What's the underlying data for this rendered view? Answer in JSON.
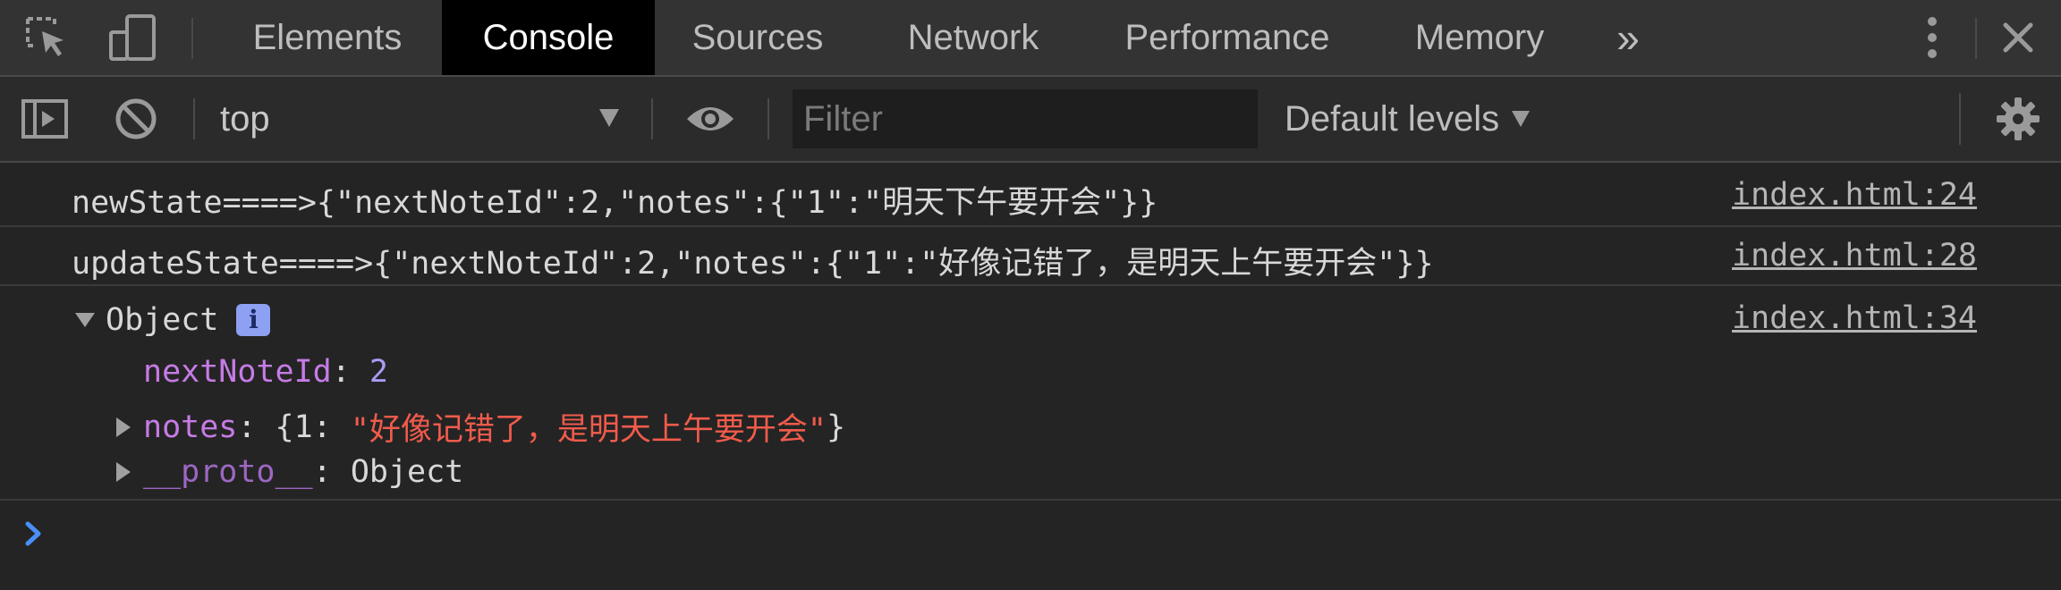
{
  "tabs": {
    "elements": "Elements",
    "console": "Console",
    "sources": "Sources",
    "network": "Network",
    "performance": "Performance",
    "memory": "Memory",
    "more": "»"
  },
  "toolbar": {
    "context": "top",
    "filter_placeholder": "Filter",
    "levels": "Default levels"
  },
  "console": {
    "messages": [
      {
        "text": "newState====>{\"nextNoteId\":2,\"notes\":{\"1\":\"明天下午要开会\"}}",
        "source": "index.html:24"
      },
      {
        "text": "updateState====>{\"nextNoteId\":2,\"notes\":{\"1\":\"好像记错了，是明天上午要开会\"}}",
        "source": "index.html:28"
      }
    ],
    "object": {
      "source": "index.html:34",
      "label": "Object",
      "info_badge": "i",
      "prop1_key": "nextNoteId",
      "prop1_value": "2",
      "prop2_key": "notes",
      "prop2_open": "{1: ",
      "prop2_value": "\"好像记错了，是明天上午要开会\"",
      "prop2_close": "}",
      "proto_key": "__proto__",
      "proto_value": "Object",
      "colon": ": "
    }
  },
  "colors": {
    "key": "#c67be6",
    "number": "#a99bf5",
    "string": "#f05b4b",
    "prompt": "#4a8ff7"
  }
}
